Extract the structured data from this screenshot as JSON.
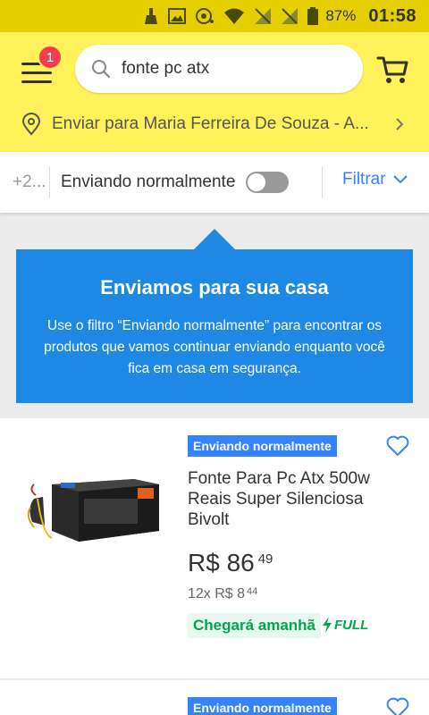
{
  "status_bar": {
    "battery": "87%",
    "time": "01:58"
  },
  "header": {
    "menu_badge": "1",
    "search_value": "fonte pc atx",
    "location": "Enviar para Maria Ferreira De Souza - A..."
  },
  "filters": {
    "more": "+2...",
    "shipping_toggle_label": "Enviando normalmente",
    "filter_label": "Filtrar"
  },
  "banner": {
    "title": "Enviamos para sua casa",
    "body": "Use o filtro “Enviando normalmente” para encontrar os produtos que vamos continuar enviando enquanto você fica em casa em segurança."
  },
  "products": [
    {
      "tag": "Enviando normalmente",
      "title": "Fonte Para Pc Atx 500w Reais Super Silenciosa Bivolt",
      "price_main": "R$ 86",
      "price_cents": "49",
      "installments_main": "12x R$ 8",
      "installments_cents": "44",
      "arrival": "Chegará amanhã",
      "fulfillment": "FULL"
    },
    {
      "tag": "Enviando normalmente"
    }
  ],
  "colors": {
    "header_yellow": "#fff159",
    "status_yellow": "#e6cf00",
    "accent_blue": "#3483fa",
    "banner_blue": "#1e88e5",
    "badge_red": "#f23d4f",
    "green": "#00a650"
  }
}
